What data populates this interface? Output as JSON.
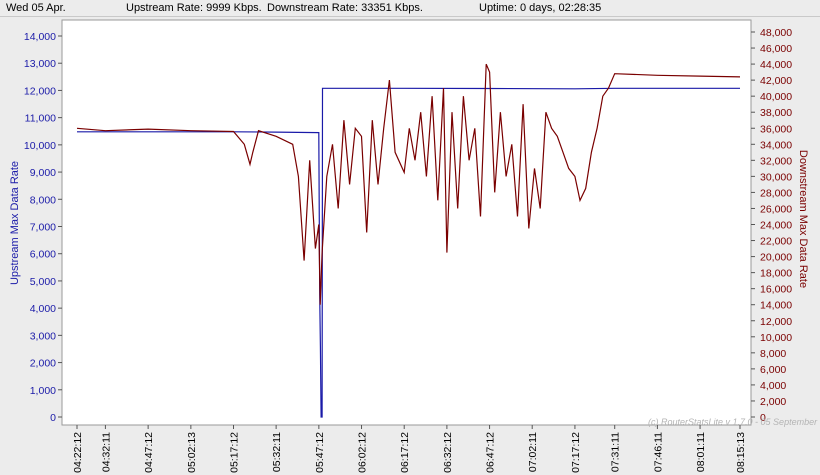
{
  "status": {
    "date": "Wed 05 Apr.",
    "upstream": "Upstream Rate: 9999 Kbps.",
    "downstream": "Downstream Rate: 33351 Kbps.",
    "uptime": "Uptime: 0 days, 02:28:35"
  },
  "watermark": "(c) RouterStatsLite v 1.7.0 - 05 September",
  "colors": {
    "upstream": "#1a1aa8",
    "downstream": "#7a0000",
    "background": "#ffffff",
    "frame": "#ececec"
  },
  "chart_data": {
    "type": "line",
    "title": "",
    "x": [
      "04:22:12",
      "04:32:11",
      "04:47:12",
      "05:02:13",
      "05:17:12",
      "05:32:11",
      "05:47:12",
      "06:02:12",
      "06:17:12",
      "06:32:12",
      "06:47:12",
      "07:02:11",
      "07:17:12",
      "07:31:11",
      "07:46:11",
      "08:01:11",
      "08:15:13"
    ],
    "y_left": {
      "label": "Upstream Max Data Rate",
      "lim": [
        0,
        14500
      ],
      "ticks": [
        "0",
        "1,000",
        "2,000",
        "3,000",
        "4,000",
        "5,000",
        "6,000",
        "7,000",
        "8,000",
        "9,000",
        "10,000",
        "11,000",
        "12,000",
        "13,000",
        "14,000"
      ]
    },
    "y_right": {
      "label": "Downstream Max Data Rate",
      "lim": [
        0,
        49000
      ],
      "ticks": [
        "0",
        "2,000",
        "4,000",
        "6,000",
        "8,000",
        "10,000",
        "12,000",
        "14,000",
        "16,000",
        "18,000",
        "20,000",
        "22,000",
        "24,000",
        "26,000",
        "28,000",
        "30,000",
        "32,000",
        "34,000",
        "36,000",
        "38,000",
        "40,000",
        "42,000",
        "44,000",
        "46,000",
        "48,000"
      ]
    },
    "series": [
      {
        "name": "Upstream Max Data Rate",
        "axis": "left",
        "points": [
          [
            "04:22:12",
            10480
          ],
          [
            "05:17:12",
            10480
          ],
          [
            "05:32:11",
            10470
          ],
          [
            "05:47:12",
            10450
          ],
          [
            "05:47:30",
            4500
          ],
          [
            "05:47:45",
            2600
          ],
          [
            "05:48:00",
            0
          ],
          [
            "05:48:20",
            0
          ],
          [
            "05:48:30",
            12080
          ],
          [
            "06:17:12",
            12080
          ],
          [
            "06:47:12",
            12070
          ],
          [
            "07:17:12",
            12060
          ],
          [
            "07:31:11",
            12080
          ],
          [
            "08:15:13",
            12080
          ]
        ]
      },
      {
        "name": "Downstream Max Data Rate",
        "axis": "right",
        "points": [
          [
            "04:22:12",
            36000
          ],
          [
            "04:32:11",
            35700
          ],
          [
            "04:47:12",
            35900
          ],
          [
            "05:02:13",
            35700
          ],
          [
            "05:17:12",
            35600
          ],
          [
            "05:21:00",
            34000
          ],
          [
            "05:23:00",
            31500
          ],
          [
            "05:24:00",
            33000
          ],
          [
            "05:26:00",
            35700
          ],
          [
            "05:32:11",
            35000
          ],
          [
            "05:38:00",
            34000
          ],
          [
            "05:40:00",
            30000
          ],
          [
            "05:42:00",
            19500
          ],
          [
            "05:44:00",
            32000
          ],
          [
            "05:46:00",
            21000
          ],
          [
            "05:47:12",
            24000
          ],
          [
            "05:47:40",
            14000
          ],
          [
            "05:48:20",
            20500
          ],
          [
            "05:50:00",
            30000
          ],
          [
            "05:52:00",
            34000
          ],
          [
            "05:54:00",
            26000
          ],
          [
            "05:56:00",
            37000
          ],
          [
            "05:58:00",
            29000
          ],
          [
            "06:00:00",
            36000
          ],
          [
            "06:02:12",
            35000
          ],
          [
            "06:04:00",
            23000
          ],
          [
            "06:06:00",
            37000
          ],
          [
            "06:08:00",
            29000
          ],
          [
            "06:10:00",
            36000
          ],
          [
            "06:12:00",
            42000
          ],
          [
            "06:14:00",
            33000
          ],
          [
            "06:17:12",
            30500
          ],
          [
            "06:19:00",
            36000
          ],
          [
            "06:21:00",
            32000
          ],
          [
            "06:23:00",
            38000
          ],
          [
            "06:25:00",
            30000
          ],
          [
            "06:27:00",
            40000
          ],
          [
            "06:29:00",
            27000
          ],
          [
            "06:31:00",
            41000
          ],
          [
            "06:32:12",
            20500
          ],
          [
            "06:34:00",
            38000
          ],
          [
            "06:36:00",
            26000
          ],
          [
            "06:38:00",
            40000
          ],
          [
            "06:40:00",
            32000
          ],
          [
            "06:42:00",
            36000
          ],
          [
            "06:44:00",
            25000
          ],
          [
            "06:46:00",
            44000
          ],
          [
            "06:47:12",
            43000
          ],
          [
            "06:49:00",
            28000
          ],
          [
            "06:51:00",
            38000
          ],
          [
            "06:53:00",
            30000
          ],
          [
            "06:55:00",
            34000
          ],
          [
            "06:57:00",
            25000
          ],
          [
            "06:59:00",
            39000
          ],
          [
            "07:01:00",
            23500
          ],
          [
            "07:03:00",
            31000
          ],
          [
            "07:05:00",
            26000
          ],
          [
            "07:07:00",
            38000
          ],
          [
            "07:09:00",
            36000
          ],
          [
            "07:11:00",
            35000
          ],
          [
            "07:13:00",
            33000
          ],
          [
            "07:15:00",
            31000
          ],
          [
            "07:17:12",
            30000
          ],
          [
            "07:19:00",
            27000
          ],
          [
            "07:21:00",
            28500
          ],
          [
            "07:23:00",
            33000
          ],
          [
            "07:25:00",
            36000
          ],
          [
            "07:27:00",
            40000
          ],
          [
            "07:29:00",
            41000
          ],
          [
            "07:31:11",
            42800
          ],
          [
            "07:46:11",
            42600
          ],
          [
            "08:01:11",
            42500
          ],
          [
            "08:15:13",
            42400
          ]
        ]
      }
    ],
    "grid": false,
    "legend": "none"
  }
}
